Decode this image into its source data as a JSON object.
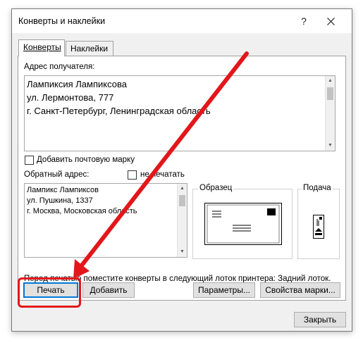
{
  "window": {
    "title": "Конверты и наклейки",
    "help": "?",
    "close_icon": "close-icon"
  },
  "tabs": [
    {
      "label": "Конверты",
      "active": true
    },
    {
      "label": "Наклейки",
      "active": false
    }
  ],
  "recipient": {
    "label": "Адрес получателя:",
    "lines": [
      "Лампиксия Лампиксова",
      "ул. Лермонтова, 777",
      "г. Санкт-Петербург, Ленинградская область"
    ]
  },
  "add_stamp": {
    "label": "Добавить почтовую марку",
    "checked": false
  },
  "return": {
    "label": "Обратный адрес:",
    "lines": [
      "Лампикс Лампиксов",
      "ул. Пушкина, 1337",
      "г. Москва, Московская область"
    ]
  },
  "omit": {
    "label": "не печатать",
    "checked": false
  },
  "preview": {
    "label": "Образец"
  },
  "feed": {
    "label": "Подача"
  },
  "note": "Перед печатью поместите конверты в следующий лоток принтера: Задний лоток.",
  "buttons": {
    "print": "Печать",
    "add": "Добавить",
    "options": "Параметры...",
    "stamp_props": "Свойства марки...",
    "close": "Закрыть"
  },
  "annotation": {
    "color": "#e3161a"
  }
}
